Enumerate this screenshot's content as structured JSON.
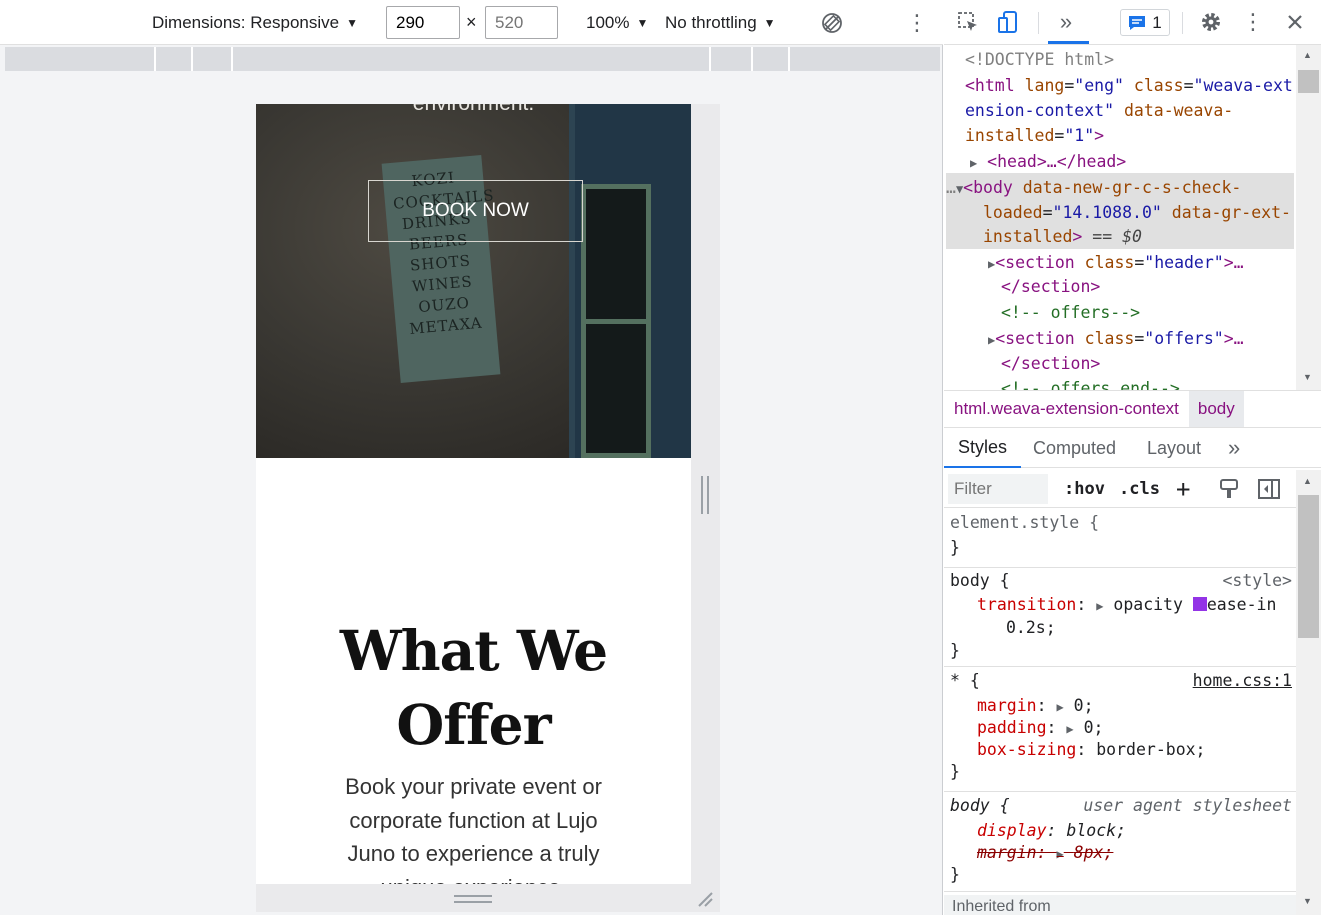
{
  "device_toolbar": {
    "dimensions_label": "Dimensions: Responsive",
    "width_value": "290",
    "height_placeholder": "520",
    "times_sign": "×",
    "zoom": "100%",
    "throttling": "No throttling"
  },
  "page": {
    "hero_text": "environment.",
    "book_button": "BOOK NOW",
    "sign_lines": [
      "KOZI",
      "COCKTAILS",
      "DRINKS",
      "BEERS",
      "SHOTS",
      "WINES",
      "OUZO",
      "METAXA"
    ],
    "offer_title": "What We Offer",
    "offer_text": "Book your private event or corporate function at Lujo Juno to experience a truly unique experience."
  },
  "devtools": {
    "issues_count": "1",
    "tree": {
      "doctype": "<!DOCTYPE html>",
      "html_tag": "<html",
      "html_attr1_name": "lang",
      "html_attr1_value": "\"eng\"",
      "html_attr2_name": "class",
      "html_attr2_value_a": "\"weava-ext",
      "html_attr2_value_b": "ension-context\"",
      "html_attr3_name_a": "data-weava-",
      "html_attr3_name_b": "installed",
      "html_attr3_value": "\"1\"",
      "head": "<head>…</head>",
      "body_tag": "<body",
      "body_attr1_name": "data-new-gr-c-s-check-",
      "body_attr1_name_b": "loaded",
      "body_attr1_value": "\"14.1088.0\"",
      "body_attr2_name": "data-gr-ext-",
      "body_attr2_name_b": "installed",
      "body_eq": "== $0",
      "section_header_tag": "<section",
      "section_header_attr": "class",
      "section_header_value": "\"header\"",
      "section_close": "</section>",
      "comment_offers": "<!-- offers-->",
      "section_offers_value": "\"offers\"",
      "comment_offers_end": "<!-- offers end-->"
    },
    "breadcrumbs": [
      "html.weava-extension-context",
      "body"
    ],
    "sub_tabs": [
      "Styles",
      "Computed",
      "Layout"
    ],
    "filter_placeholder": "Filter",
    "hov": ":hov",
    "cls": ".cls",
    "rules": {
      "element_style": "element.style {",
      "close": "}",
      "body_selector": "body {",
      "body_source": "<style>",
      "transition_name": "transition",
      "transition_value_a": "opacity",
      "transition_value_b": "ease-in",
      "transition_value_c": "0.2s;",
      "star_selector": "* {",
      "star_source": "home.css:1",
      "margin_name": "margin",
      "margin_value": "0;",
      "padding_name": "padding",
      "padding_value": "0;",
      "boxsizing_name": "box-sizing",
      "boxsizing_value": "border-box;",
      "ua_selector": "body {",
      "ua_source": "user agent stylesheet",
      "display_name": "display",
      "display_value": "block;",
      "ua_margin_name": "margin",
      "ua_margin_value": "8px;",
      "inherited": "Inherited from"
    }
  }
}
